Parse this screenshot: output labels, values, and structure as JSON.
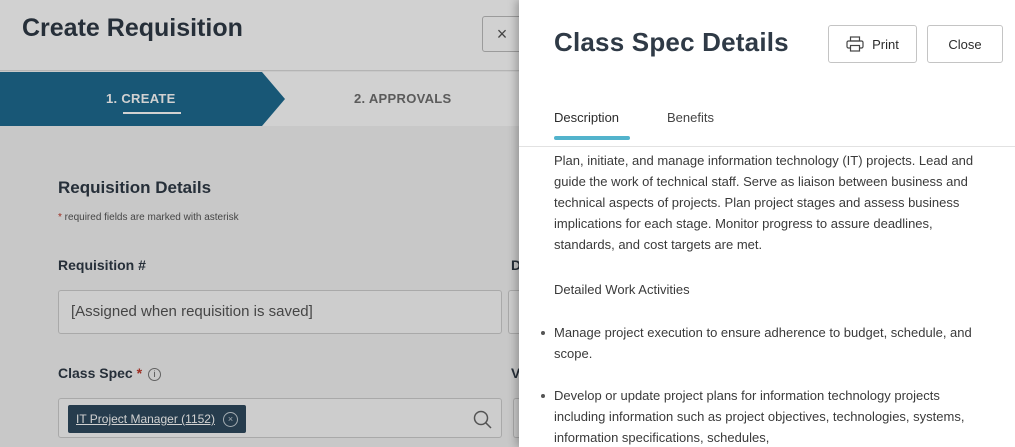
{
  "background_form": {
    "title": "Create Requisition",
    "close_glyph": "×",
    "steps": [
      {
        "label": "1. CREATE",
        "active": true
      },
      {
        "label": "2. APPROVALS",
        "active": false
      }
    ],
    "section_title": "Requisition Details",
    "required_note_star": "*",
    "required_note": " required fields are marked with asterisk",
    "requisition_label": "Requisition #",
    "requisition_value": "[Assigned when requisition is saved]",
    "cut_label_1": "D",
    "class_spec_label": "Class Spec",
    "class_spec_star": "*",
    "info_glyph": "i",
    "cut_label_2": "V",
    "class_spec_chip": "IT Project Manager (1152)",
    "chip_remove_glyph": "×"
  },
  "panel": {
    "title": "Class Spec Details",
    "print_label": "Print",
    "close_label": "Close",
    "tabs": [
      {
        "label": "Description",
        "active": true
      },
      {
        "label": "Benefits",
        "active": false
      }
    ],
    "description": "Plan, initiate, and manage information technology (IT) projects. Lead and guide the work of technical staff. Serve as liaison between business and technical aspects of projects. Plan project stages and assess business implications for each stage. Monitor progress to assure deadlines, standards, and cost targets are met.",
    "activities_title": "Detailed Work Activities",
    "activities": [
      "Manage project execution to ensure adherence to budget, schedule, and scope.",
      "Develop or update project plans for information technology projects including information such as project objectives, technologies, systems, information specifications, schedules,"
    ]
  },
  "colors": {
    "step_active": "#1e6b91",
    "tab_underline": "#52b3cc",
    "chip": "#2f4a5e",
    "required_star": "#c0392b"
  }
}
